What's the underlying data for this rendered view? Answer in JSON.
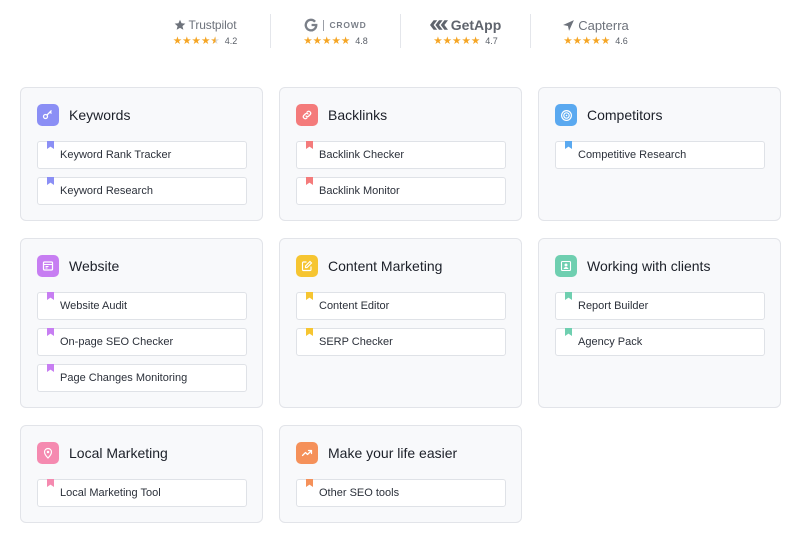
{
  "ratings": [
    {
      "brand": "Trustpilot",
      "stars": 4.5,
      "score": "4.2"
    },
    {
      "brand": "CROWD",
      "stars": 5,
      "score": "4.8"
    },
    {
      "brand": "GetApp",
      "stars": 5,
      "score": "4.7"
    },
    {
      "brand": "Capterra",
      "stars": 5,
      "score": "4.6"
    }
  ],
  "colors": {
    "star": "#f5a524",
    "keywords": "#8b8ff5",
    "backlinks": "#f47b7b",
    "competitors": "#5aa9f0",
    "website": "#c77ef2",
    "content_marketing": "#f6c531",
    "working_with_clients": "#6fcfb0",
    "local_marketing": "#f58ab0",
    "make_your_life_easier": "#f5915a"
  },
  "categories": {
    "keywords": {
      "title": "Keywords",
      "icon": "key-icon",
      "items": [
        "Keyword Rank Tracker",
        "Keyword Research"
      ]
    },
    "backlinks": {
      "title": "Backlinks",
      "icon": "link-icon",
      "items": [
        "Backlink Checker",
        "Backlink Monitor"
      ]
    },
    "competitors": {
      "title": "Competitors",
      "icon": "target-icon",
      "items": [
        "Competitive Research"
      ]
    },
    "website": {
      "title": "Website",
      "icon": "browser-icon",
      "items": [
        "Website Audit",
        "On-page SEO Checker",
        "Page Changes Monitoring"
      ]
    },
    "content_marketing": {
      "title": "Content Marketing",
      "icon": "edit-icon",
      "items": [
        "Content Editor",
        "SERP Checker"
      ]
    },
    "working_with_clients": {
      "title": "Working with clients",
      "icon": "user-icon",
      "items": [
        "Report Builder",
        "Agency Pack"
      ]
    },
    "local_marketing": {
      "title": "Local Marketing",
      "icon": "map-pin-icon",
      "items": [
        "Local Marketing Tool"
      ]
    },
    "make_your_life_easier": {
      "title": "Make your life easier",
      "icon": "trend-up-icon",
      "items": [
        "Other SEO tools"
      ]
    }
  }
}
